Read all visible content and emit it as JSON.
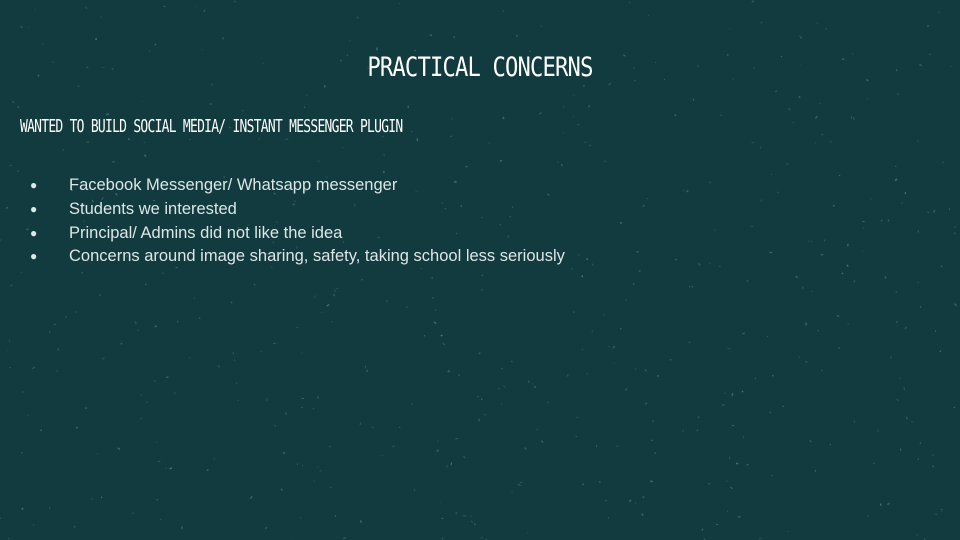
{
  "slide": {
    "title": "PRACTICAL CONCERNS",
    "subtitle": "WANTED TO BUILD SOCIAL MEDIA/ INSTANT MESSENGER PLUGIN",
    "bullet_symbol": "●",
    "bullets": [
      "Facebook Messenger/ Whatsapp messenger",
      "Students we interested",
      "Principal/ Admins did not like the idea",
      "Concerns around image sharing, safety, taking school less seriously"
    ]
  },
  "colors": {
    "background": "#123b40",
    "text": "#ffffff",
    "bullet_text": "#dde6e6",
    "speckle": "#5f8a8c"
  }
}
